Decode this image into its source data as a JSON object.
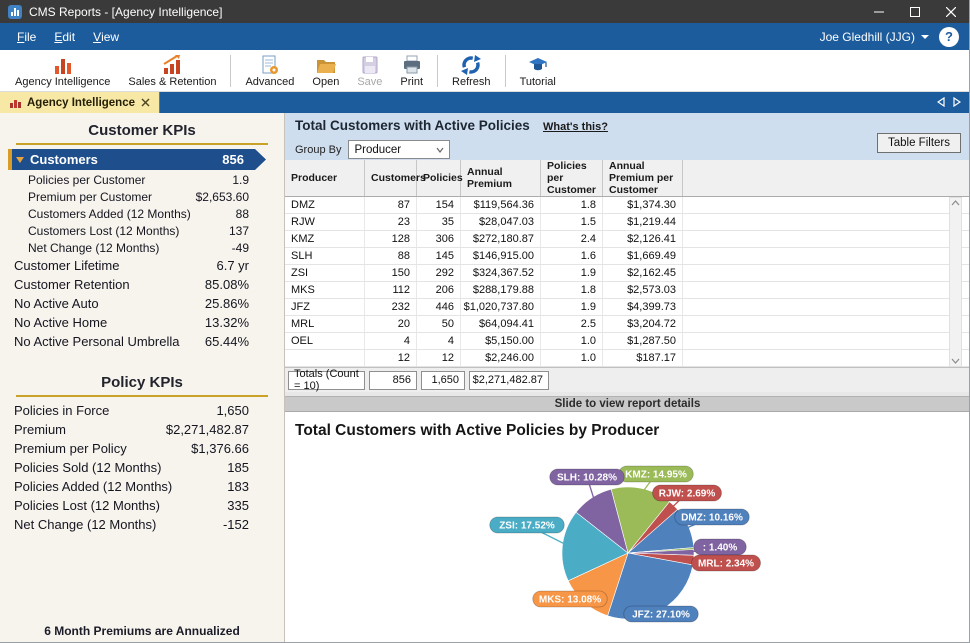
{
  "window": {
    "title": "CMS Reports - [Agency Intelligence]"
  },
  "menu": {
    "items": [
      {
        "label": "File"
      },
      {
        "label": "Edit"
      },
      {
        "label": "View"
      }
    ],
    "user": "Joe Gledhill (JJG)",
    "help": "?"
  },
  "toolbar": {
    "buttons": [
      {
        "id": "agency-intelligence",
        "label": "Agency Intelligence",
        "enabled": true
      },
      {
        "id": "sales-retention",
        "label": "Sales & Retention",
        "enabled": true
      },
      {
        "id": "advanced",
        "label": "Advanced",
        "enabled": true
      },
      {
        "id": "open",
        "label": "Open",
        "enabled": true
      },
      {
        "id": "save",
        "label": "Save",
        "enabled": false
      },
      {
        "id": "print",
        "label": "Print",
        "enabled": true
      },
      {
        "id": "refresh",
        "label": "Refresh",
        "enabled": true
      },
      {
        "id": "tutorial",
        "label": "Tutorial",
        "enabled": true
      }
    ]
  },
  "tabs": {
    "active": "Agency Intelligence"
  },
  "sidebar": {
    "customer_kpis": {
      "title": "Customer KPIs",
      "items": [
        {
          "label": "Customers",
          "value": "856",
          "selected": true
        },
        {
          "label": "Policies per Customer",
          "value": "1.9",
          "indent": true
        },
        {
          "label": "Premium per Customer",
          "value": "$2,653.60",
          "indent": true
        },
        {
          "label": "Customers Added (12 Months)",
          "value": "88",
          "indent": true
        },
        {
          "label": "Customers Lost (12 Months)",
          "value": "137",
          "indent": true
        },
        {
          "label": "Net Change (12 Months)",
          "value": "-49",
          "indent": true
        },
        {
          "label": "Customer Lifetime",
          "value": "6.7 yr"
        },
        {
          "label": "Customer Retention",
          "value": "85.08%"
        },
        {
          "label": "No Active Auto",
          "value": "25.86%"
        },
        {
          "label": "No Active Home",
          "value": "13.32%"
        },
        {
          "label": "No Active Personal Umbrella",
          "value": "65.44%"
        }
      ]
    },
    "policy_kpis": {
      "title": "Policy KPIs",
      "items": [
        {
          "label": "Policies in Force",
          "value": "1,650"
        },
        {
          "label": "Premium",
          "value": "$2,271,482.87"
        },
        {
          "label": "Premium per Policy",
          "value": "$1,376.66"
        },
        {
          "label": "Policies Sold (12 Months)",
          "value": "185"
        },
        {
          "label": "Policies Added (12 Months)",
          "value": "183"
        },
        {
          "label": "Policies Lost (12 Months)",
          "value": "335"
        },
        {
          "label": "Net Change (12 Months)",
          "value": "-152"
        }
      ]
    },
    "footnote": "6 Month Premiums are Annualized"
  },
  "report": {
    "title": "Total Customers with Active Policies",
    "whats_this": "What's this?",
    "group_by_label": "Group By",
    "group_by_value": "Producer",
    "table_filters_label": "Table Filters",
    "splitter_label": "Slide to view report details",
    "table": {
      "columns": [
        "Producer",
        "Customers",
        "Policies",
        "Annual Premium",
        "Policies per Customer",
        "Annual Premium per Customer"
      ],
      "rows": [
        [
          "DMZ",
          "87",
          "154",
          "$119,564.36",
          "1.8",
          "$1,374.30"
        ],
        [
          "RJW",
          "23",
          "35",
          "$28,047.03",
          "1.5",
          "$1,219.44"
        ],
        [
          "KMZ",
          "128",
          "306",
          "$272,180.87",
          "2.4",
          "$2,126.41"
        ],
        [
          "SLH",
          "88",
          "145",
          "$146,915.00",
          "1.6",
          "$1,669.49"
        ],
        [
          "ZSI",
          "150",
          "292",
          "$324,367.52",
          "1.9",
          "$2,162.45"
        ],
        [
          "MKS",
          "112",
          "206",
          "$288,179.88",
          "1.8",
          "$2,573.03"
        ],
        [
          "JFZ",
          "232",
          "446",
          "$1,020,737.80",
          "1.9",
          "$4,399.73"
        ],
        [
          "MRL",
          "20",
          "50",
          "$64,094.41",
          "2.5",
          "$3,204.72"
        ],
        [
          "OEL",
          "4",
          "4",
          "$5,150.00",
          "1.0",
          "$1,287.50"
        ],
        [
          "",
          "12",
          "12",
          "$2,246.00",
          "1.0",
          "$187.17"
        ]
      ],
      "totals": {
        "label": "Totals (Count = 10)",
        "customers": "856",
        "policies": "1,650",
        "premium": "$2,271,482.87"
      }
    }
  },
  "chart_data": {
    "type": "pie",
    "title": "Total Customers with Active Policies by Producer",
    "start_angle_deg": -14.8,
    "direction": "clockwise",
    "legend_position": "callout-labels",
    "slices": [
      {
        "name": "KMZ",
        "pct": 14.95,
        "color": "#9bbb59",
        "label": "KMZ: 14.95%",
        "label_offset": [
          28,
          -79
        ]
      },
      {
        "name": "RJW",
        "pct": 2.69,
        "color": "#c0504d",
        "label": "RJW: 2.69%",
        "label_offset": [
          59,
          -60
        ]
      },
      {
        "name": "DMZ",
        "pct": 10.16,
        "color": "#4f81bd",
        "label": "DMZ: 10.16%",
        "label_offset": [
          84,
          -36
        ]
      },
      {
        "name": "OEL",
        "pct": 0.47,
        "color": "#9bbb59",
        "label": null,
        "label_offset": null
      },
      {
        "name": "",
        "pct": 1.4,
        "color": "#8064a2",
        "label": ": 1.40%",
        "label_offset": [
          92,
          -6
        ]
      },
      {
        "name": "MRL",
        "pct": 2.34,
        "color": "#c0504d",
        "label": "MRL: 2.34%",
        "label_offset": [
          98,
          10
        ]
      },
      {
        "name": "JFZ",
        "pct": 27.1,
        "color": "#4f81bd",
        "label": "JFZ: 27.10%",
        "label_offset": [
          33,
          61
        ]
      },
      {
        "name": "MKS",
        "pct": 13.08,
        "color": "#f79646",
        "label": "MKS: 13.08%",
        "label_offset": [
          -58,
          46
        ]
      },
      {
        "name": "ZSI",
        "pct": 17.52,
        "color": "#4bacc6",
        "label": "ZSI: 17.52%",
        "label_offset": [
          -101,
          -28
        ]
      },
      {
        "name": "SLH",
        "pct": 10.28,
        "color": "#8064a2",
        "label": "SLH: 10.28%",
        "label_offset": [
          -41,
          -76
        ]
      }
    ]
  }
}
